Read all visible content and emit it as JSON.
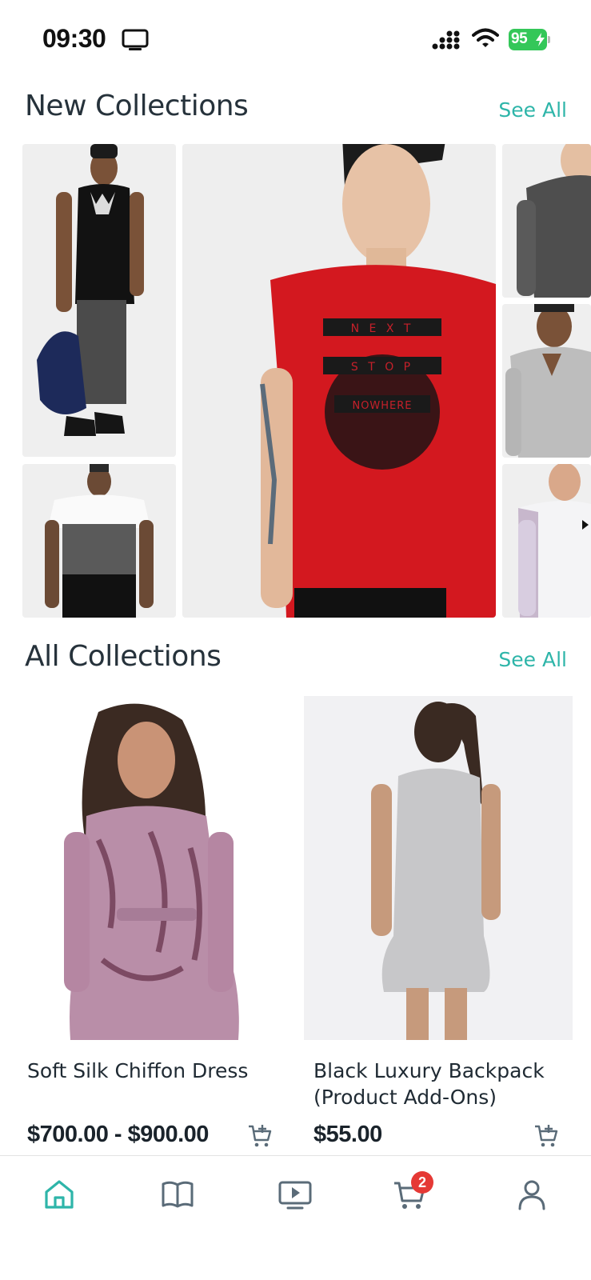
{
  "status_bar": {
    "time": "09:30",
    "battery": "95"
  },
  "new_collections": {
    "title": "New Collections",
    "see_all": "See All"
  },
  "all_collections": {
    "title": "All Collections",
    "see_all": "See All",
    "products": [
      {
        "name": "Soft Silk Chiffon Dress",
        "price": "$700.00 - $900.00"
      },
      {
        "name": "Black Luxury Backpack (Product Add-Ons)",
        "price": "$55.00"
      }
    ]
  },
  "featured_shirt_print": [
    "N E X T",
    "S T O P",
    "NOWHERE"
  ],
  "bottom_nav": {
    "items": [
      "home-icon",
      "catalog-book-icon",
      "video-icon",
      "cart-icon",
      "profile-icon"
    ],
    "cart_count": "2"
  },
  "colors": {
    "accent": "#2eb5a9",
    "badge": "#e53935",
    "battery": "#34c759"
  }
}
